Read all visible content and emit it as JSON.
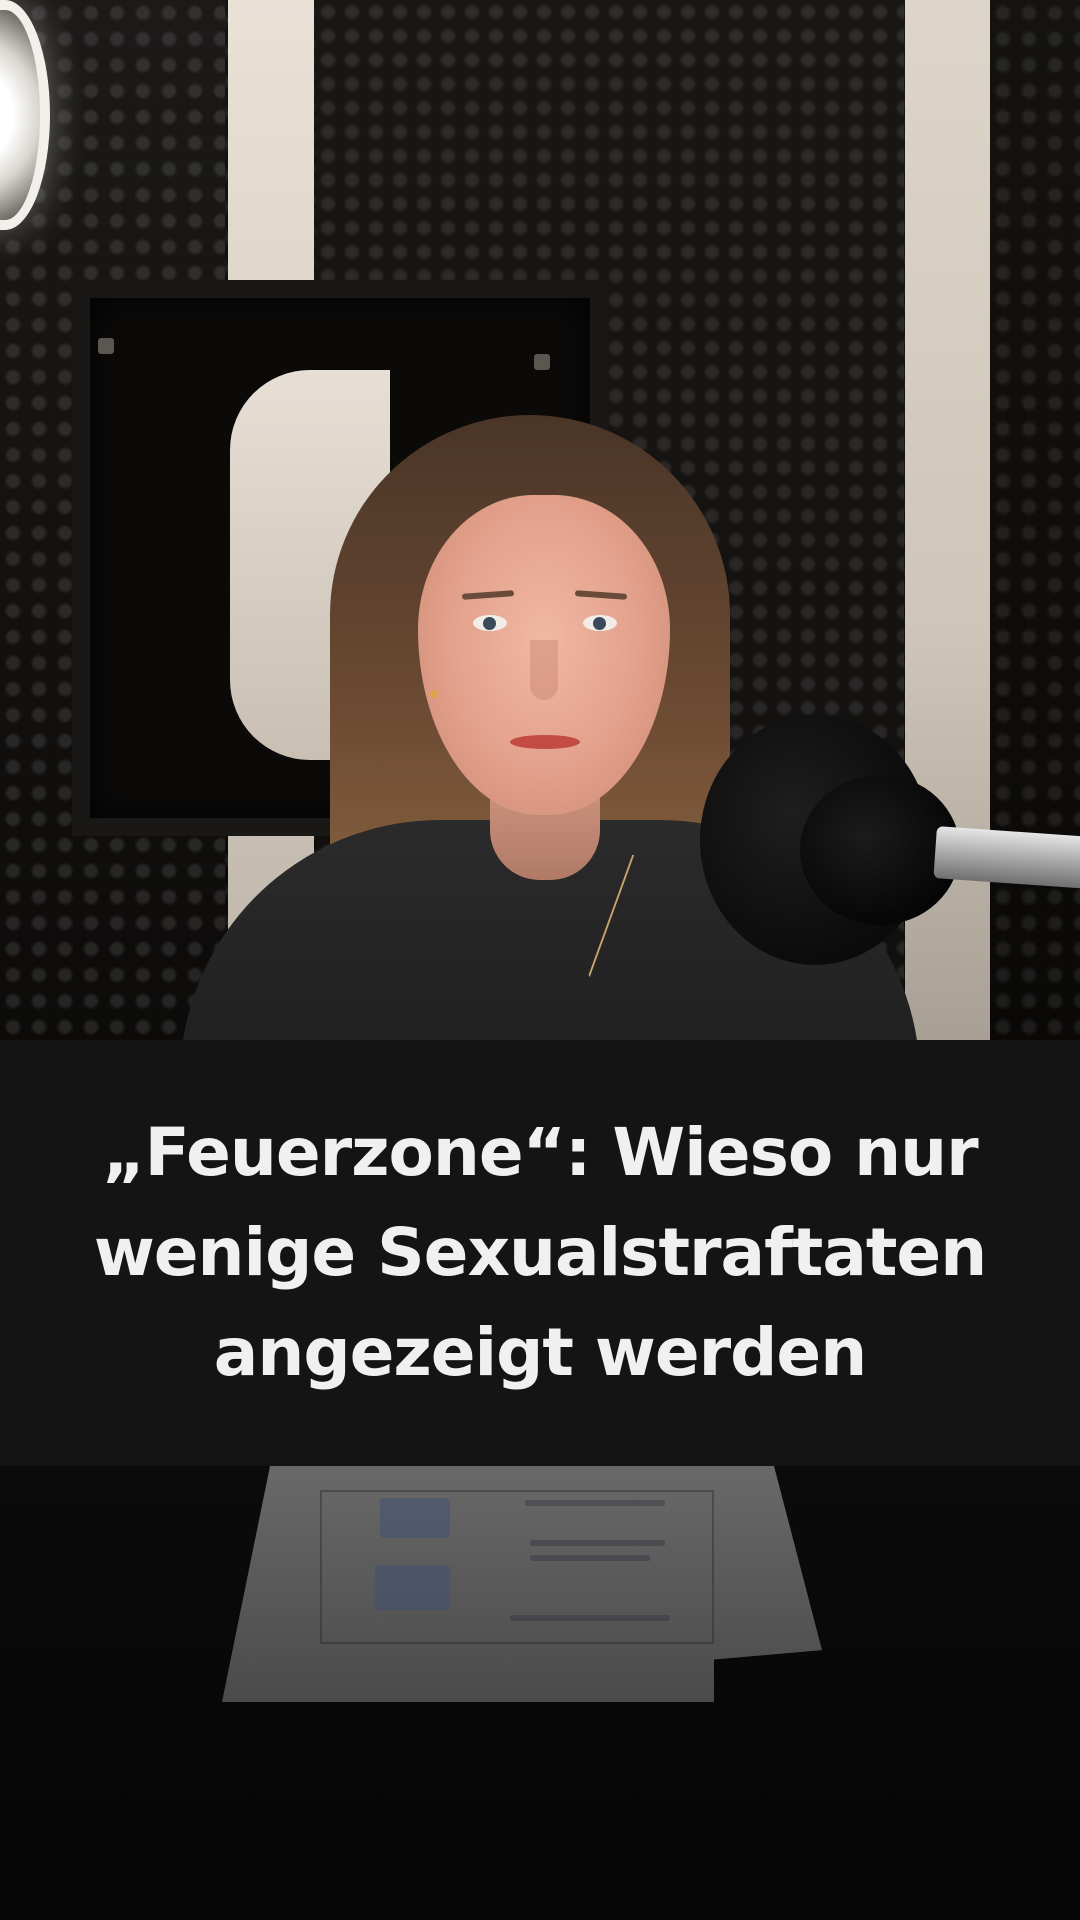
{
  "video_title": "„Feuerzone“: Wieso nur wenige Sexualstraftaten angezeigt werden",
  "video_title_lines": [
    "„Feuerzone“: Wieso nur",
    "wenige Sexualstraftaten",
    "angezeigt werden"
  ],
  "colors": {
    "banner_background": "#141414",
    "title_text": "#f0f0f0",
    "scene_background": "#050505"
  }
}
